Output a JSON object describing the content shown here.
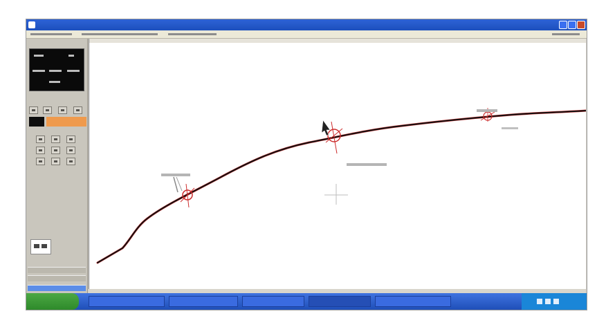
{
  "window": {
    "title": "",
    "controls": [
      "minimize-icon",
      "maximize-icon",
      "close-icon"
    ]
  },
  "canvas": {
    "annotations": [
      "",
      "",
      "",
      ""
    ]
  },
  "colors": {
    "titlebar": "#1c4fbd",
    "taskbar": "#2358c8",
    "start_button": "#3a9a34",
    "curve": "#111111",
    "marker": "#cc2b2b",
    "mode_orange": "#ef9a4d"
  },
  "icons": {
    "cursor": "cursor-arrow-icon",
    "crosshair": "crosshair-icon",
    "markers": "circle-marker-icon"
  },
  "caption": ""
}
